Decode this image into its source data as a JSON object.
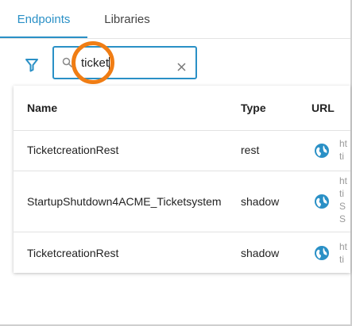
{
  "tabs": [
    {
      "label": "Endpoints",
      "active": true
    },
    {
      "label": "Libraries",
      "active": false
    }
  ],
  "filter": {
    "icon": "filter-icon"
  },
  "search": {
    "value": "ticket",
    "clear_icon": "close-icon",
    "search_icon": "search-icon"
  },
  "table": {
    "headers": {
      "name": "Name",
      "type": "Type",
      "url": "URL"
    },
    "rows": [
      {
        "name": "TicketcreationRest",
        "type": "rest",
        "url_icon": "globe-icon",
        "url_fragment": "ht\nti"
      },
      {
        "name": "StartupShutdown4ACME_Ticketsystem",
        "type": "shadow",
        "url_icon": "globe-icon",
        "url_fragment": "ht\nti\nS\nS"
      },
      {
        "name": "TicketcreationRest",
        "type": "shadow",
        "url_icon": "globe-icon",
        "url_fragment": "ht\nti"
      }
    ]
  },
  "colors": {
    "accent": "#2a90c6",
    "highlight": "#f07d14"
  }
}
